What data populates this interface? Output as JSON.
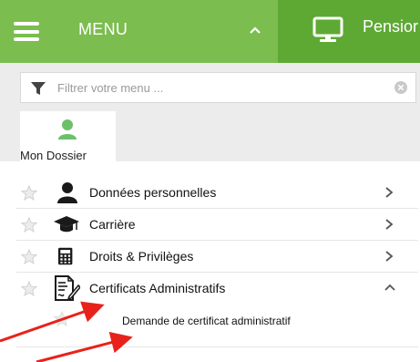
{
  "header": {
    "menu_label": "MENU",
    "right_label": "Pensior",
    "accent_left": "#7bbd4e",
    "accent_right": "#5ea934"
  },
  "filter": {
    "placeholder": "Filtrer votre menu ..."
  },
  "tile": {
    "label": "Mon Dossier"
  },
  "menu": {
    "items": [
      {
        "label": "Données personnelles",
        "icon": "person-icon",
        "chevron": "right"
      },
      {
        "label": "Carrière",
        "icon": "graduation-cap-icon",
        "chevron": "right"
      },
      {
        "label": "Droits & Privilèges",
        "icon": "calculator-icon",
        "chevron": "right"
      },
      {
        "label": "Certificats Administratifs",
        "icon": "certificate-icon",
        "chevron": "up"
      }
    ],
    "subitem": {
      "label": "Demande de certificat administratif"
    }
  },
  "annotation_color": "#e8221b"
}
